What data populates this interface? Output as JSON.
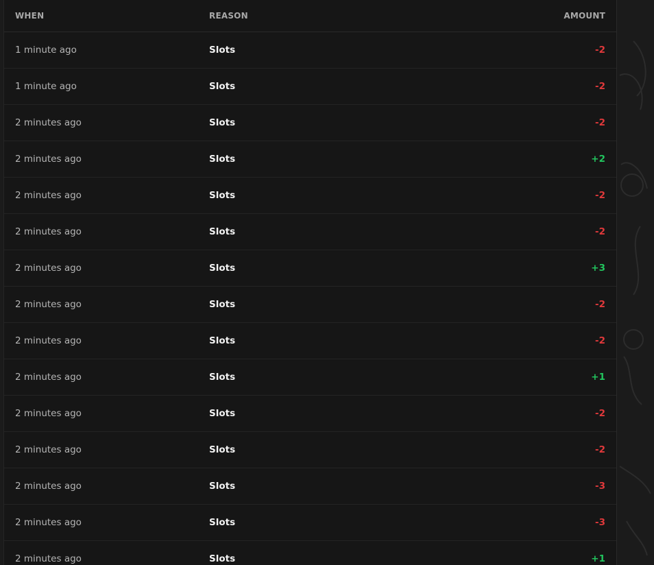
{
  "colors": {
    "negative": "#e0393b",
    "positive": "#22c55e"
  },
  "table": {
    "headers": {
      "when": "WHEN",
      "reason": "REASON",
      "amount": "AMOUNT"
    },
    "rows": [
      {
        "when": "1 minute ago",
        "reason": "Slots",
        "amount": "-2"
      },
      {
        "when": "1 minute ago",
        "reason": "Slots",
        "amount": "-2"
      },
      {
        "when": "2 minutes ago",
        "reason": "Slots",
        "amount": "-2"
      },
      {
        "when": "2 minutes ago",
        "reason": "Slots",
        "amount": "+2"
      },
      {
        "when": "2 minutes ago",
        "reason": "Slots",
        "amount": "-2"
      },
      {
        "when": "2 minutes ago",
        "reason": "Slots",
        "amount": "-2"
      },
      {
        "when": "2 minutes ago",
        "reason": "Slots",
        "amount": "+3"
      },
      {
        "when": "2 minutes ago",
        "reason": "Slots",
        "amount": "-2"
      },
      {
        "when": "2 minutes ago",
        "reason": "Slots",
        "amount": "-2"
      },
      {
        "when": "2 minutes ago",
        "reason": "Slots",
        "amount": "+1"
      },
      {
        "when": "2 minutes ago",
        "reason": "Slots",
        "amount": "-2"
      },
      {
        "when": "2 minutes ago",
        "reason": "Slots",
        "amount": "-2"
      },
      {
        "when": "2 minutes ago",
        "reason": "Slots",
        "amount": "-3"
      },
      {
        "when": "2 minutes ago",
        "reason": "Slots",
        "amount": "-3"
      },
      {
        "when": "2 minutes ago",
        "reason": "Slots",
        "amount": "+1"
      }
    ]
  }
}
